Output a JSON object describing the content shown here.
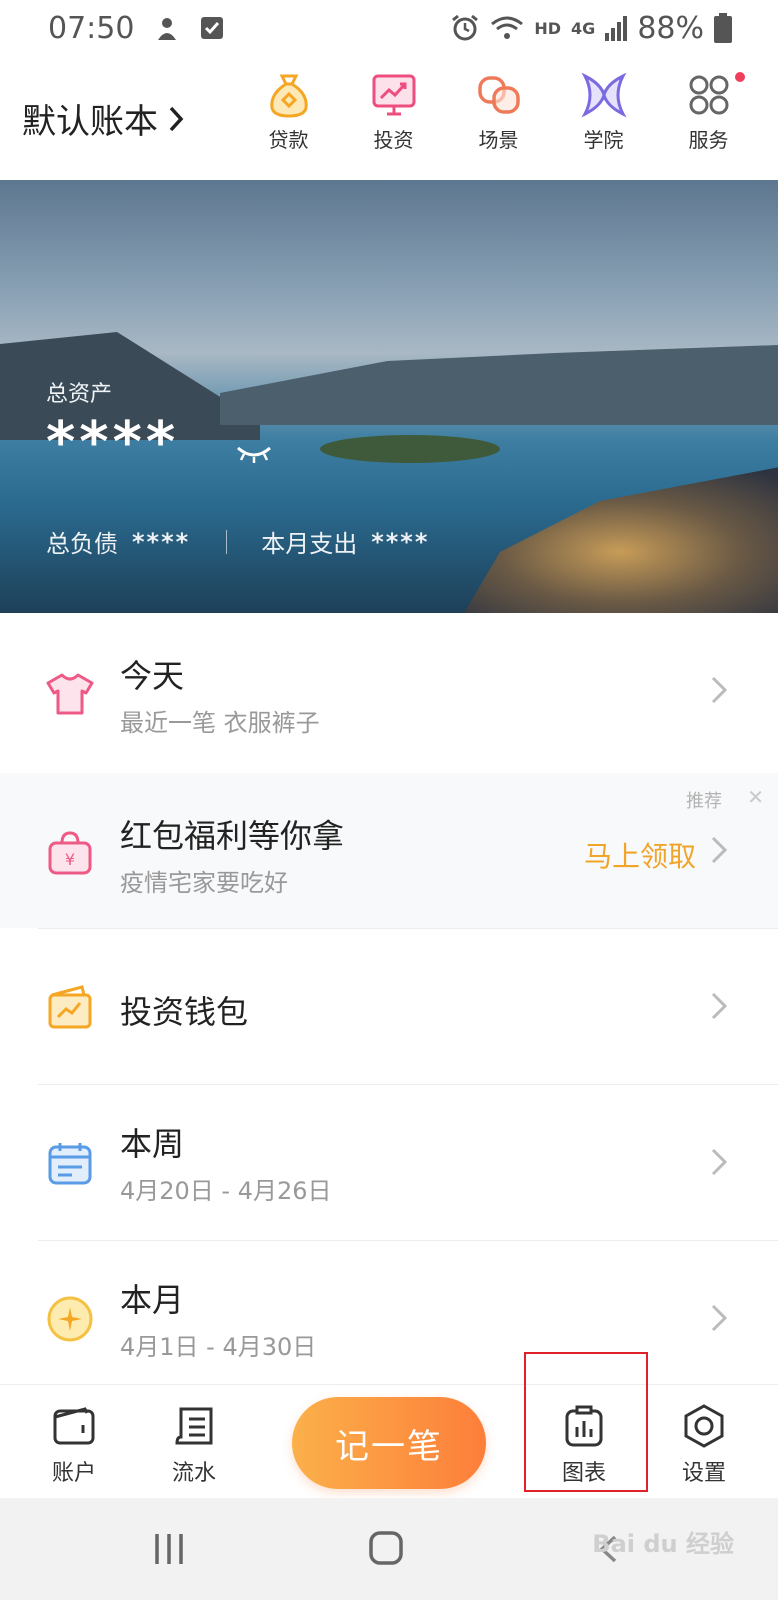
{
  "status_bar": {
    "time": "07:50",
    "network": "HD",
    "signal": "4G",
    "battery": "88%"
  },
  "header": {
    "book_title": "默认账本",
    "nav": [
      {
        "label": "贷款",
        "icon": "money-bag-icon"
      },
      {
        "label": "投资",
        "icon": "investment-chart-icon"
      },
      {
        "label": "场景",
        "icon": "scene-knot-icon"
      },
      {
        "label": "学院",
        "icon": "academy-icon"
      },
      {
        "label": "服务",
        "icon": "services-grid-icon"
      }
    ]
  },
  "banner": {
    "assets_label": "总资产",
    "assets_value": "****",
    "liabilities_label": "总负债",
    "liabilities_value": "****",
    "month_expense_label": "本月支出",
    "month_expense_value": "****"
  },
  "list": {
    "today": {
      "title": "今天",
      "subtitle": "最近一笔 衣服裤子"
    },
    "promo": {
      "title": "红包福利等你拿",
      "subtitle": "疫情宅家要吃好",
      "tag": "推荐",
      "close": "✕",
      "action": "马上领取"
    },
    "wallet": {
      "title": "投资钱包"
    },
    "week": {
      "title": "本周",
      "subtitle": "4月20日 - 4月26日"
    },
    "month": {
      "title": "本月",
      "subtitle": "4月1日 - 4月30日"
    }
  },
  "tabbar": {
    "accounts": "账户",
    "flow": "流水",
    "record": "记一笔",
    "charts": "图表",
    "settings": "设置"
  },
  "watermark": "Bai du 经验",
  "colors": {
    "accent_orange": "#fd7e3a",
    "promo_action": "#f0a52a",
    "highlight": "#e0202a",
    "notification_dot": "#ef3f5c"
  }
}
